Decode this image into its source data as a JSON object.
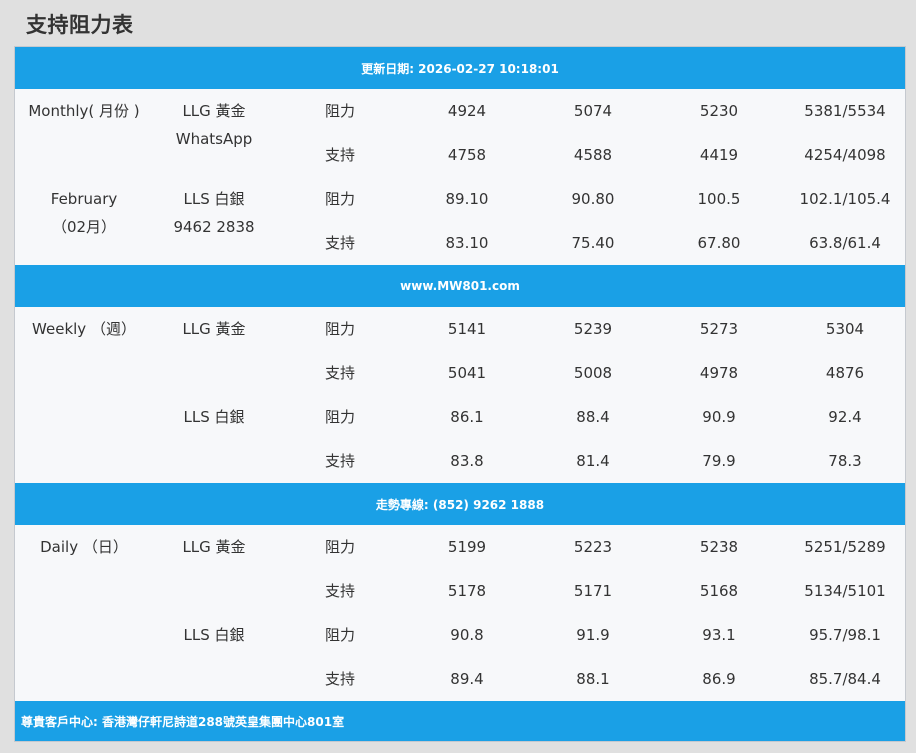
{
  "page_title": "支持阻力表",
  "banners": {
    "update": "更新日期: 2026-02-27 10:18:01",
    "website": "www.MW801.com",
    "hotline": "走勢專線: (852) 9262 1888",
    "address": "尊貴客戶中心: 香港灣仔軒尼詩道288號英皇集團中心801室"
  },
  "monthly": {
    "period_line1": "Monthly( 月份 )",
    "period_line2": "February",
    "period_line3": "（02月）",
    "gold_label": "LLG 黃金",
    "gold_sub": "WhatsApp",
    "silver_label": "LLS 白銀",
    "silver_sub": "9462 2838",
    "rows": [
      {
        "kind": "阻力",
        "values": [
          "4924",
          "5074",
          "5230",
          "5381/5534"
        ]
      },
      {
        "kind": "支持",
        "values": [
          "4758",
          "4588",
          "4419",
          "4254/4098"
        ]
      },
      {
        "kind": "阻力",
        "values": [
          "89.10",
          "90.80",
          "100.5",
          "102.1/105.4"
        ]
      },
      {
        "kind": "支持",
        "values": [
          "83.10",
          "75.40",
          "67.80",
          "63.8/61.4"
        ]
      }
    ]
  },
  "weekly": {
    "period_line1": "Weekly （週）",
    "gold_label": "LLG 黃金",
    "silver_label": "LLS 白銀",
    "rows": [
      {
        "kind": "阻力",
        "values": [
          "5141",
          "5239",
          "5273",
          "5304"
        ]
      },
      {
        "kind": "支持",
        "values": [
          "5041",
          "5008",
          "4978",
          "4876"
        ]
      },
      {
        "kind": "阻力",
        "values": [
          "86.1",
          "88.4",
          "90.9",
          "92.4"
        ]
      },
      {
        "kind": "支持",
        "values": [
          "83.8",
          "81.4",
          "79.9",
          "78.3"
        ]
      }
    ]
  },
  "daily": {
    "period_line1": "Daily （日）",
    "gold_label": "LLG 黃金",
    "silver_label": "LLS 白銀",
    "rows": [
      {
        "kind": "阻力",
        "values": [
          "5199",
          "5223",
          "5238",
          "5251/5289"
        ]
      },
      {
        "kind": "支持",
        "values": [
          "5178",
          "5171",
          "5168",
          "5134/5101"
        ]
      },
      {
        "kind": "阻力",
        "values": [
          "90.8",
          "91.9",
          "93.1",
          "95.7/98.1"
        ]
      },
      {
        "kind": "支持",
        "values": [
          "89.4",
          "88.1",
          "86.9",
          "85.7/84.4"
        ]
      }
    ]
  },
  "colors": {
    "band": "#1aa0e6",
    "panel": "#f7f8fa",
    "background": "#e0e0e0",
    "text": "#333333"
  }
}
